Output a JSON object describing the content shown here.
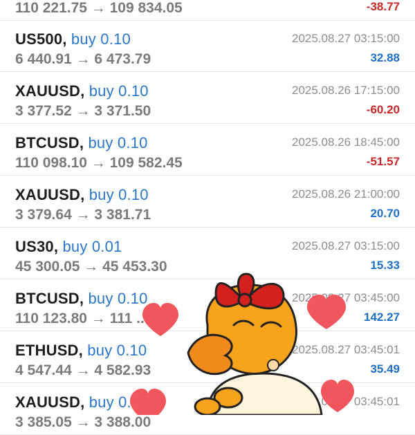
{
  "top_partial": {
    "prices": "110 221.75 → 109 834.05",
    "profit": "-38.77",
    "profit_color": "#c62828"
  },
  "trades": [
    {
      "symbol": "US500",
      "side": "buy 0.10",
      "prices": "6 440.91 → 6 473.79",
      "time": "2025.08.27 03:15:00",
      "profit": "32.88",
      "sign": "pos"
    },
    {
      "symbol": "XAUUSD",
      "side": "buy 0.10",
      "prices": "3 377.52 → 3 371.50",
      "time": "2025.08.26 17:15:00",
      "profit": "-60.20",
      "sign": "neg"
    },
    {
      "symbol": "BTCUSD",
      "side": "buy 0.10",
      "prices": "110 098.10 → 109 582.45",
      "time": "2025.08.26 18:45:00",
      "profit": "-51.57",
      "sign": "neg"
    },
    {
      "symbol": "XAUUSD",
      "side": "buy 0.10",
      "prices": "3 379.64 → 3 381.71",
      "time": "2025.08.26 21:00:00",
      "profit": "20.70",
      "sign": "pos"
    },
    {
      "symbol": "US30",
      "side": "buy 0.01",
      "prices": "45 300.05 → 45 453.30",
      "time": "2025.08.27 03:15:00",
      "profit": "15.33",
      "sign": "pos"
    },
    {
      "symbol": "BTCUSD",
      "side": "buy 0.10",
      "prices": "110 123.80 → 111 ... 50",
      "time": "2025.08.27 03:45:00",
      "profit": "142.27",
      "sign": "pos"
    },
    {
      "symbol": "ETHUSD",
      "side": "buy 0.10",
      "prices": "4 547.44 → 4 582.93",
      "time": "2025.08.27 03:45:01",
      "profit": "35.49",
      "sign": "pos"
    },
    {
      "symbol": "XAUUSD",
      "side": "buy 0.10",
      "prices": "3 385.05 → 3 388.00",
      "time": "2025.08.27 03:45:01",
      "profit": "",
      "sign": "pos"
    }
  ],
  "colors": {
    "symbol": "#1c1c1c",
    "side": "#2a76c6",
    "prices": "#7a7a7a",
    "time": "#8c8c8c",
    "profit_positive": "#1e6fc2",
    "profit_negative": "#c62828",
    "heart": "#f0565c",
    "duck": "#f7a31c",
    "bow": "#d3211f"
  },
  "sticker": {
    "name": "duck-with-bow-sticker",
    "hearts": 5
  }
}
